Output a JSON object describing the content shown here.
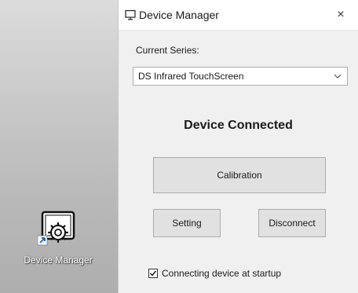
{
  "desktop": {
    "icon_name": "device-manager-icon",
    "icon_label": "Device Manager"
  },
  "window": {
    "title": "Device Manager",
    "title_icon": "monitor-icon",
    "close_glyph": "×"
  },
  "series": {
    "label": "Current Series:",
    "selected": "DS Infrared TouchScreen"
  },
  "status": {
    "text": "Device Connected"
  },
  "buttons": {
    "calibration": "Calibration",
    "setting": "Setting",
    "disconnect": "Disconnect"
  },
  "startup": {
    "label": "Connecting device at startup",
    "checked": true
  }
}
